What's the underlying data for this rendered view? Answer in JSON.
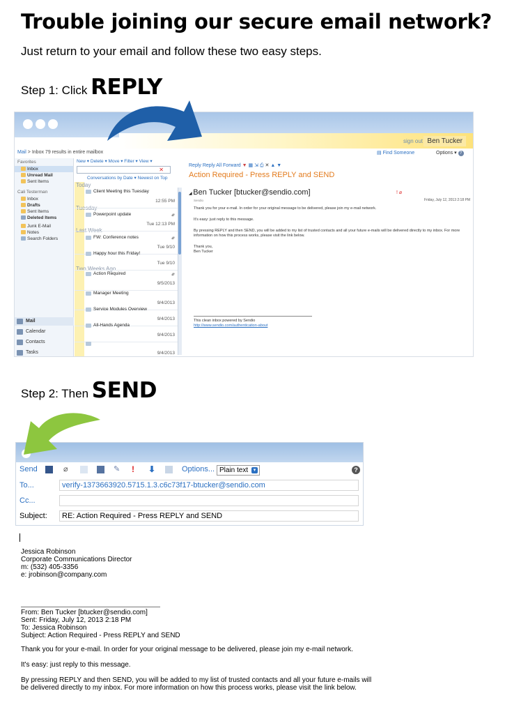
{
  "headline": "Trouble joining our secure email network?",
  "intro": "Just return to your email and follow these two easy steps.",
  "step1": {
    "label": "Step 1: Click",
    "action": "REPLY"
  },
  "step2": {
    "label": "Step 2: Then",
    "action": "SEND"
  },
  "arrow_colors": {
    "step1": "#1f5fa8",
    "step2": "#8dc63f"
  },
  "shot1": {
    "sign_out": "sign out",
    "user": "Ben Tucker",
    "breadcrumb": {
      "mail": "Mail",
      "sep": ">",
      "inbox": "Inbox",
      "results": "79 results in entire mailbox"
    },
    "find_someone": "Find Someone",
    "options": "Options",
    "nav": {
      "favorites": "Favorites",
      "fav_items": [
        "Inbox",
        "Unread Mail",
        "Sent Items"
      ],
      "account": "Cali Testerman",
      "account_items": [
        "Inbox",
        "Drafts",
        "Sent Items",
        "Deleted Items",
        "Junk E-Mail",
        "Notes",
        "Search Folders"
      ],
      "bottom": [
        "Mail",
        "Calendar",
        "Contacts",
        "Tasks"
      ]
    },
    "list_tools": "New ▾  Delete ▾  Move ▾  Filter ▾  View ▾",
    "list_sort": "Conversations by Date ▾   Newest on Top",
    "groups": [
      "Today",
      "Tuesday",
      "Last Week",
      "Two Weeks Ago"
    ],
    "messages": [
      {
        "subject": "Client Meeting this Tuesday",
        "date": "12:55 PM"
      },
      {
        "subject": "Powerpoint update",
        "date": "Tue 12:13 PM"
      },
      {
        "subject": "FW: Conference notes",
        "date": "Tue 9/10"
      },
      {
        "subject": "Happy hour this Friday!",
        "date": "Tue 9/10"
      },
      {
        "subject": "Action Required",
        "date": "9/5/2013"
      },
      {
        "subject": "Manager Meeting",
        "date": "9/4/2013"
      },
      {
        "subject": "Service Modules Overview",
        "date": "9/4/2013"
      },
      {
        "subject": "All-Hands Agenda",
        "date": "9/4/2013"
      },
      {
        "subject": "",
        "date": "9/4/2013"
      }
    ],
    "reader_tools": "Reply   Reply All   Forward",
    "subject": "Action Required - Press REPLY and SEND",
    "sender": "Ben Tucker [btucker@sendio.com]",
    "org": "Sendio",
    "date": "Friday, July 12, 2013 2:18 PM",
    "body": [
      "Thank you for your e-mail. In order for your original message to be delivered, please join my e-mail network.",
      "It's easy: just reply to this message.",
      "By pressing REPLY and then SEND, you will be added to my list of trusted contacts and all your future e-mails will be delivered directly to my inbox. For more information on how this process works, please visit the link below.",
      "Thank you,",
      "Ben Tucker"
    ],
    "footer": "This clean inbox powered by Sendio",
    "footer_link": "http://www.sendio.com/authentication-about"
  },
  "shot2": {
    "send": "Send",
    "options": "Options...",
    "format": "Plain text",
    "to_label": "To...",
    "to_value": "verify-1373663920.5715.1.3.c6c73f17-btucker@sendio.com",
    "cc_label": "Cc...",
    "subject_label": "Subject:",
    "subject_value": "RE: Action Required - Press REPLY and SEND"
  },
  "signature": [
    "Jessica Robinson",
    "Corporate Communications Director",
    "m: (532) 405-3356",
    "e: jrobinson@company.com"
  ],
  "quoted_header": [
    "From: Ben Tucker [btucker@sendio.com]",
    "Sent: Friday, July 12, 2013 2:18 PM",
    "To: Jessica Robinson",
    "Subject: Action Required - Press REPLY and SEND"
  ],
  "quoted_body": [
    "Thank you for your e-mail. In order for your original message to be delivered, please join my e-mail network.",
    "It's easy: just reply to this message.",
    "By pressing REPLY and then SEND, you will be added to my list of trusted contacts and all your future e-mails will",
    "be delivered directly to my inbox. For more information on how this process works, please visit the link below."
  ]
}
